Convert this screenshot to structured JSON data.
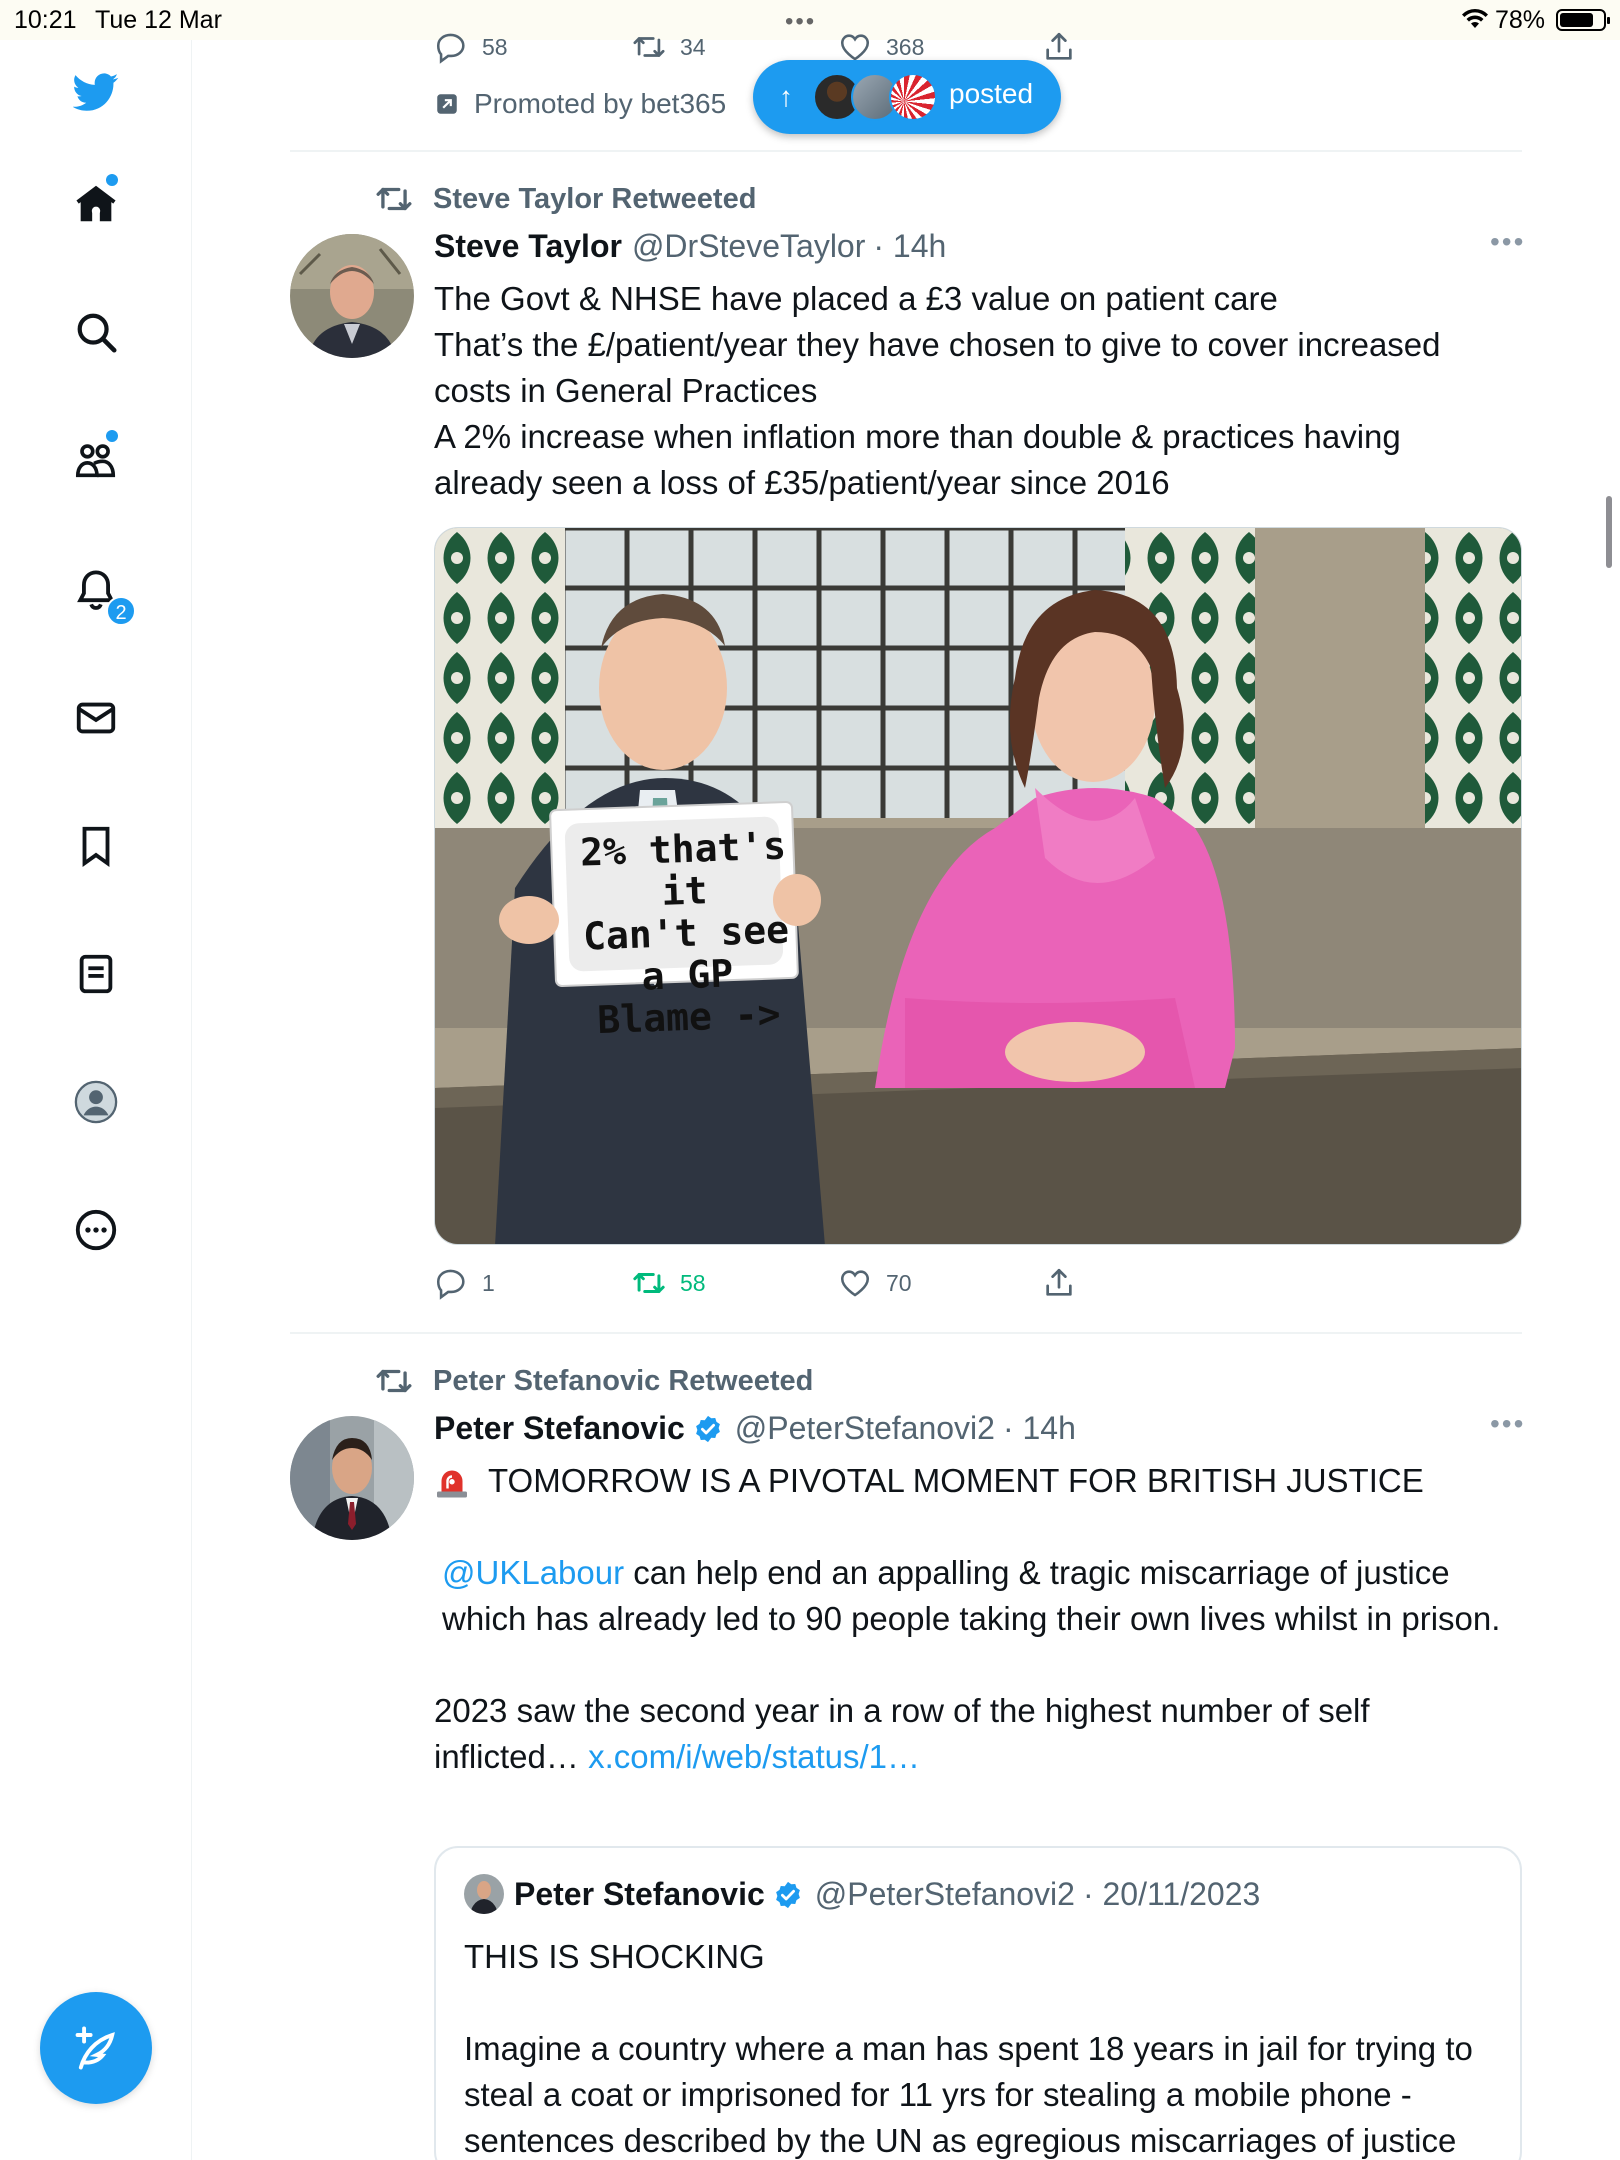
{
  "status_bar": {
    "time": "10:21",
    "date": "Tue 12 Mar",
    "battery_pct": "78%",
    "battery_level": 0.78
  },
  "sidebar": {
    "items": [
      {
        "name": "home",
        "icon": "home-icon",
        "has_dot": true
      },
      {
        "name": "explore",
        "icon": "search-icon"
      },
      {
        "name": "communities",
        "icon": "communities-icon",
        "has_dot": true
      },
      {
        "name": "notifications",
        "icon": "bell-icon",
        "badge": "2"
      },
      {
        "name": "messages",
        "icon": "mail-icon"
      },
      {
        "name": "bookmarks",
        "icon": "bookmark-icon"
      },
      {
        "name": "lists",
        "icon": "list-icon"
      },
      {
        "name": "profile",
        "icon": "profile-icon"
      },
      {
        "name": "more",
        "icon": "more-icon"
      }
    ],
    "compose_icon": "compose-icon"
  },
  "previous_tweet": {
    "replies": "58",
    "retweets": "34",
    "likes": "368",
    "promoted": "Promoted by bet365"
  },
  "posted_pill": {
    "label": "posted"
  },
  "tweet1": {
    "retweeted_by": "Steve Taylor Retweeted",
    "name": "Steve Taylor",
    "handle": "@DrSteveTaylor",
    "time": "· 14h",
    "lines": [
      "The Govt & NHSE have placed a £3 value on patient care",
      "That’s the £/patient/year they have chosen to give to cover increased",
      "costs in General Practices",
      "A 2% increase when inflation more than double & practices having",
      "already seen a loss of £35/patient/year since 2016"
    ],
    "image_sign": [
      "2% that's it",
      "Can't see a GP",
      "Blame ->"
    ],
    "replies": "1",
    "retweets": "58",
    "likes": "70"
  },
  "tweet2": {
    "retweeted_by": "Peter Stefanovic Retweeted",
    "name": "Peter Stefanovic",
    "handle": "@PeterStefanovi2",
    "time": "· 14h",
    "headline": "TOMORROW IS A PIVOTAL MOMENT FOR BRITISH JUSTICE",
    "mention": "@UKLabour",
    "para1_rest": " can help end an appalling & tragic miscarriage of justice which has already led to 90 people taking their own lives whilst in prison.",
    "para2": "2023 saw the second year in a row of the highest number of self inflicted…",
    "para2_link": "x.com/i/web/status/1…",
    "quote": {
      "name": "Peter Stefanovic",
      "handle": "@PeterStefanovi2",
      "date": "· 20/11/2023",
      "title": "THIS IS SHOCKING",
      "body": "Imagine a country where a man has spent 18 years in jail for trying to steal a coat or imprisoned for 11 yrs for stealing a mobile phone - sentences described by the UN as egregious miscarriages of justice"
    }
  }
}
